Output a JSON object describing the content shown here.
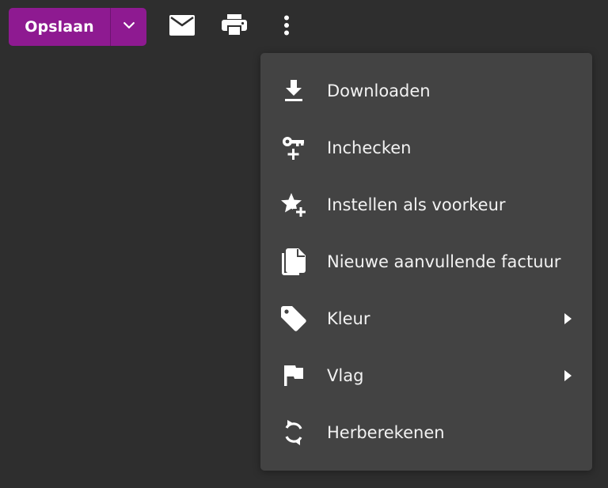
{
  "toolbar": {
    "save_label": "Opslaan",
    "icons": [
      "chevron-down-icon",
      "mail-icon",
      "print-icon",
      "more-vertical-icon"
    ]
  },
  "colors": {
    "accent": "#8e1a91",
    "background": "#2e2e2e",
    "menu_background": "#434343",
    "text": "#f2f2f2"
  },
  "menu": {
    "items": [
      {
        "label": "Downloaden",
        "icon": "download-icon",
        "submenu": false
      },
      {
        "label": "Inchecken",
        "icon": "key-plus-icon",
        "submenu": false
      },
      {
        "label": "Instellen als voorkeur",
        "icon": "star-plus-icon",
        "submenu": false
      },
      {
        "label": "Nieuwe aanvullende factuur",
        "icon": "file-copy-icon",
        "submenu": false
      },
      {
        "label": "Kleur",
        "icon": "tag-icon",
        "submenu": true
      },
      {
        "label": "Vlag",
        "icon": "flag-icon",
        "submenu": true
      },
      {
        "label": "Herberekenen",
        "icon": "sync-icon",
        "submenu": false
      }
    ]
  }
}
